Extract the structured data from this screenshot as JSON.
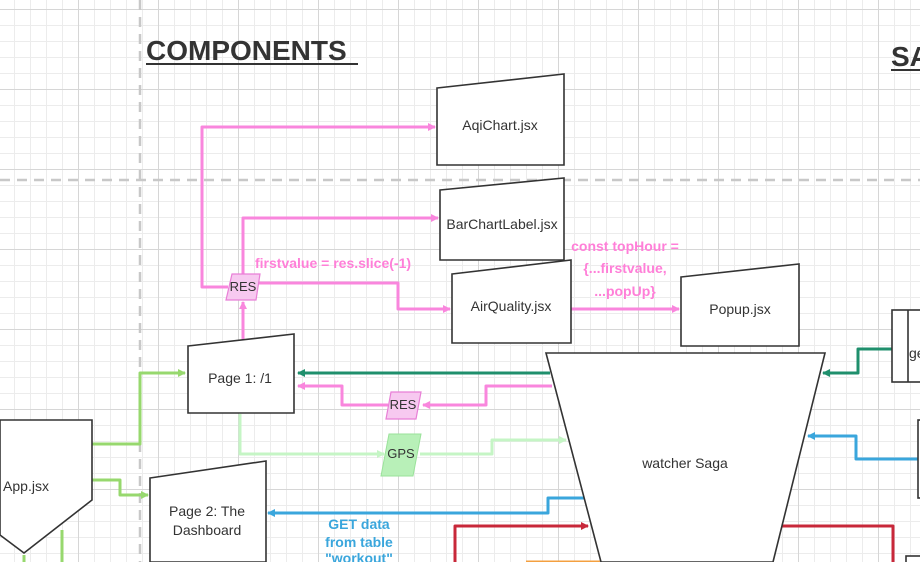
{
  "headings": {
    "components": "COMPONENTS",
    "sagas_partial": "SA"
  },
  "nodes": {
    "aqichart": "AqiChart.jsx",
    "barchartlabel": "BarChartLabel.jsx",
    "airquality": "AirQuality.jsx",
    "popup": "Popup.jsx",
    "page1": "Page 1: /1",
    "page2_line1": "Page 2: The",
    "page2_line2": "Dashboard",
    "app": "App.jsx",
    "watcher": "watcher Saga",
    "partial_ge": "ge"
  },
  "badges": {
    "res_top": "RES",
    "res_mid": "RES",
    "gps": "GPS"
  },
  "notes": {
    "firstvalue": "firstvalue = res.slice(-1)",
    "tophour_1": "const topHour =",
    "tophour_2": "{...firstvalue,",
    "tophour_3": "...popUp}",
    "getdata_1": "GET data",
    "getdata_2": "from table",
    "getdata_3": "\"workout\""
  },
  "colors": {
    "pink": "#f986dd",
    "green": "#97d86e",
    "light_green": "#c5f5c5",
    "teal": "#1f8f6c",
    "blue": "#3aa6dc",
    "red": "#c8283a",
    "orange": "#f4a040"
  }
}
